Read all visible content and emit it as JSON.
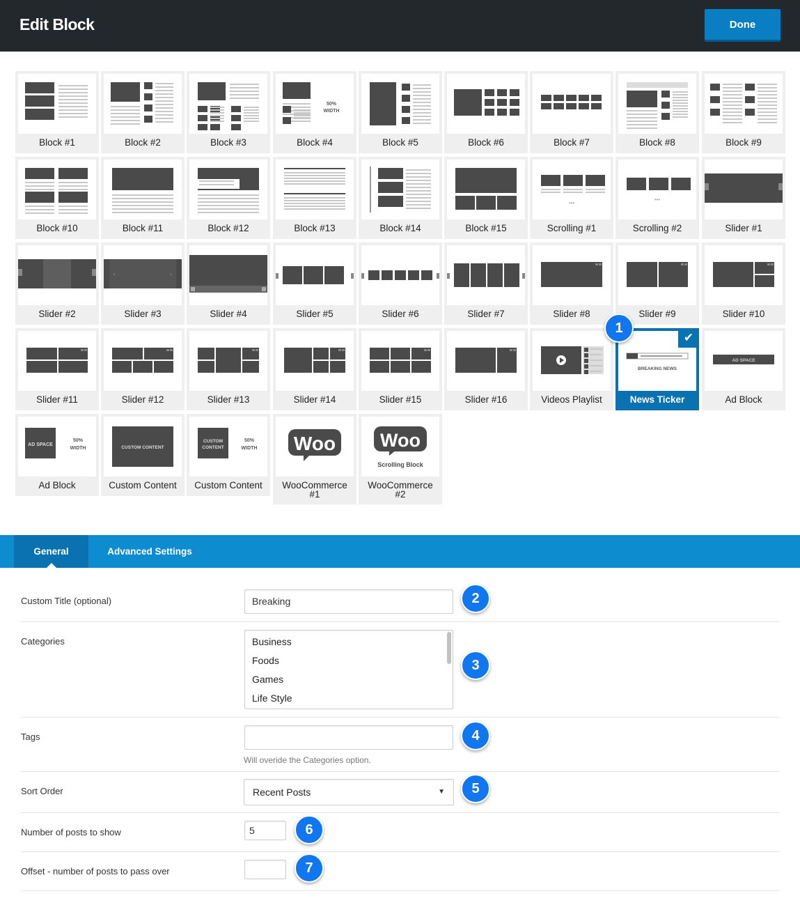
{
  "header": {
    "title": "Edit Block",
    "done_label": "Done"
  },
  "blocks": [
    {
      "label": "Block #1"
    },
    {
      "label": "Block #2"
    },
    {
      "label": "Block #3"
    },
    {
      "label": "Block #4",
      "overlay": "50% WIDTH"
    },
    {
      "label": "Block #5"
    },
    {
      "label": "Block #6"
    },
    {
      "label": "Block #7"
    },
    {
      "label": "Block #8"
    },
    {
      "label": "Block #9"
    },
    {
      "label": "Block #10"
    },
    {
      "label": "Block #11"
    },
    {
      "label": "Block #12"
    },
    {
      "label": "Block #13"
    },
    {
      "label": "Block #14"
    },
    {
      "label": "Block #15"
    },
    {
      "label": "Scrolling #1"
    },
    {
      "label": "Scrolling #2"
    },
    {
      "label": "Slider #1"
    },
    {
      "label": "Slider #2"
    },
    {
      "label": "Slider #3"
    },
    {
      "label": "Slider #4"
    },
    {
      "label": "Slider #5"
    },
    {
      "label": "Slider #6"
    },
    {
      "label": "Slider #7"
    },
    {
      "label": "Slider #8"
    },
    {
      "label": "Slider #9"
    },
    {
      "label": "Slider #10"
    },
    {
      "label": "Slider #11"
    },
    {
      "label": "Slider #12"
    },
    {
      "label": "Slider #13"
    },
    {
      "label": "Slider #14"
    },
    {
      "label": "Slider #15"
    },
    {
      "label": "Slider #16"
    },
    {
      "label": "Videos Playlist"
    },
    {
      "label": "News Ticker",
      "overlay": "BREAKING NEWS",
      "selected": true
    },
    {
      "label": "Ad Block",
      "overlay": "AD SPACE"
    },
    {
      "label": "Ad Block",
      "overlay": "AD SPACE",
      "overlay2": "50% WIDTH"
    },
    {
      "label": "Custom Content",
      "overlay": "CUSTOM CONTENT"
    },
    {
      "label": "Custom Content",
      "overlay": "CUSTOM CONTENT",
      "overlay2": "50% WIDTH"
    },
    {
      "label": "WooCommerce #1",
      "overlay": "Woo"
    },
    {
      "label": "WooCommerce #2",
      "overlay": "Woo",
      "overlay2": "Scrolling Block"
    }
  ],
  "selected_check_icon": "checkmark-icon",
  "tabs": [
    {
      "label": "General",
      "active": true
    },
    {
      "label": "Advanced Settings",
      "active": false
    }
  ],
  "form": {
    "custom_title": {
      "label": "Custom Title (optional)",
      "value": "Breaking"
    },
    "categories": {
      "label": "Categories",
      "options": [
        "Business",
        "Foods",
        "Games",
        "Life Style"
      ]
    },
    "tags": {
      "label": "Tags",
      "value": "",
      "hint": "Will overide the Categories option."
    },
    "sort_order": {
      "label": "Sort Order",
      "value": "Recent Posts"
    },
    "num_posts": {
      "label": "Number of posts to show",
      "value": "5"
    },
    "offset": {
      "label": "Offset - number of posts to pass over",
      "value": ""
    }
  },
  "badges": [
    "1",
    "2",
    "3",
    "4",
    "5",
    "6",
    "7"
  ],
  "colors": {
    "header_bg": "#23282d",
    "accent": "#0a72b1",
    "tab_bar": "#0d8ccf",
    "badge": "#1177f0"
  }
}
